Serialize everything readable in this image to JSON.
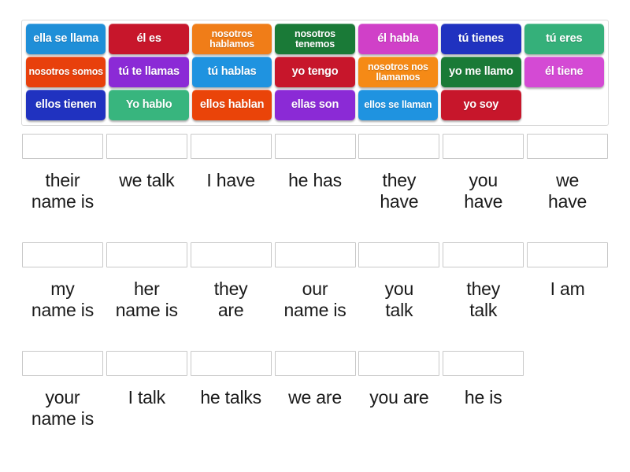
{
  "tile_bank": {
    "rows": [
      [
        {
          "text": "ella se llama",
          "color": "#1f8fd8",
          "lines": 1
        },
        {
          "text": "él es",
          "color": "#c7162b",
          "lines": 1
        },
        {
          "text": "nosotros hablamos",
          "color": "#f07d18",
          "lines": 2
        },
        {
          "text": "nosotros tenemos",
          "color": "#1a7a37",
          "lines": 2
        },
        {
          "text": "él habla",
          "color": "#d040c8",
          "lines": 1
        },
        {
          "text": "tú tienes",
          "color": "#2032c0",
          "lines": 1
        },
        {
          "text": "tú eres",
          "color": "#35b07a",
          "lines": 1
        }
      ],
      [
        {
          "text": "nosotros somos",
          "color": "#e8400c",
          "lines": 2
        },
        {
          "text": "tú te llamas",
          "color": "#8b2ad6",
          "lines": 1
        },
        {
          "text": "tú hablas",
          "color": "#1f93e0",
          "lines": 1
        },
        {
          "text": "yo tengo",
          "color": "#c7162b",
          "lines": 1
        },
        {
          "text": "nosotros nos llamamos",
          "color": "#f58a16",
          "lines": 2
        },
        {
          "text": "yo me llamo",
          "color": "#1a7a37",
          "lines": 1
        },
        {
          "text": "él tiene",
          "color": "#d44ad4",
          "lines": 1
        }
      ],
      [
        {
          "text": "ellos tienen",
          "color": "#2032c0",
          "lines": 1
        },
        {
          "text": "Yo hablo",
          "color": "#38b57e",
          "lines": 1
        },
        {
          "text": "ellos hablan",
          "color": "#ea4409",
          "lines": 1
        },
        {
          "text": "ellas son",
          "color": "#8b2ad6",
          "lines": 1
        },
        {
          "text": "ellos se llaman",
          "color": "#1f93e0",
          "lines": 2
        },
        {
          "text": "yo soy",
          "color": "#c7162b",
          "lines": 1
        },
        {
          "text": "",
          "color": "transparent",
          "lines": 0
        }
      ]
    ]
  },
  "answers": {
    "rows": [
      {
        "slots": [
          {
            "label": "their\nname is",
            "has_box": true
          },
          {
            "label": "we talk",
            "has_box": true
          },
          {
            "label": "I have",
            "has_box": true
          },
          {
            "label": "he has",
            "has_box": true
          },
          {
            "label": "they\nhave",
            "has_box": true
          },
          {
            "label": "you\nhave",
            "has_box": true
          },
          {
            "label": "we\nhave",
            "has_box": true
          }
        ]
      },
      {
        "slots": [
          {
            "label": "my\nname is",
            "has_box": true
          },
          {
            "label": "her\nname is",
            "has_box": true
          },
          {
            "label": "they\nare",
            "has_box": true
          },
          {
            "label": "our\nname is",
            "has_box": true
          },
          {
            "label": "you\ntalk",
            "has_box": true
          },
          {
            "label": "they\ntalk",
            "has_box": true
          },
          {
            "label": "I am",
            "has_box": true
          }
        ]
      },
      {
        "slots": [
          {
            "label": "your\nname is",
            "has_box": true
          },
          {
            "label": "I talk",
            "has_box": true
          },
          {
            "label": "he talks",
            "has_box": true
          },
          {
            "label": "we are",
            "has_box": true
          },
          {
            "label": "you are",
            "has_box": true
          },
          {
            "label": "he is",
            "has_box": true
          },
          {
            "label": "",
            "has_box": false
          }
        ]
      }
    ]
  }
}
